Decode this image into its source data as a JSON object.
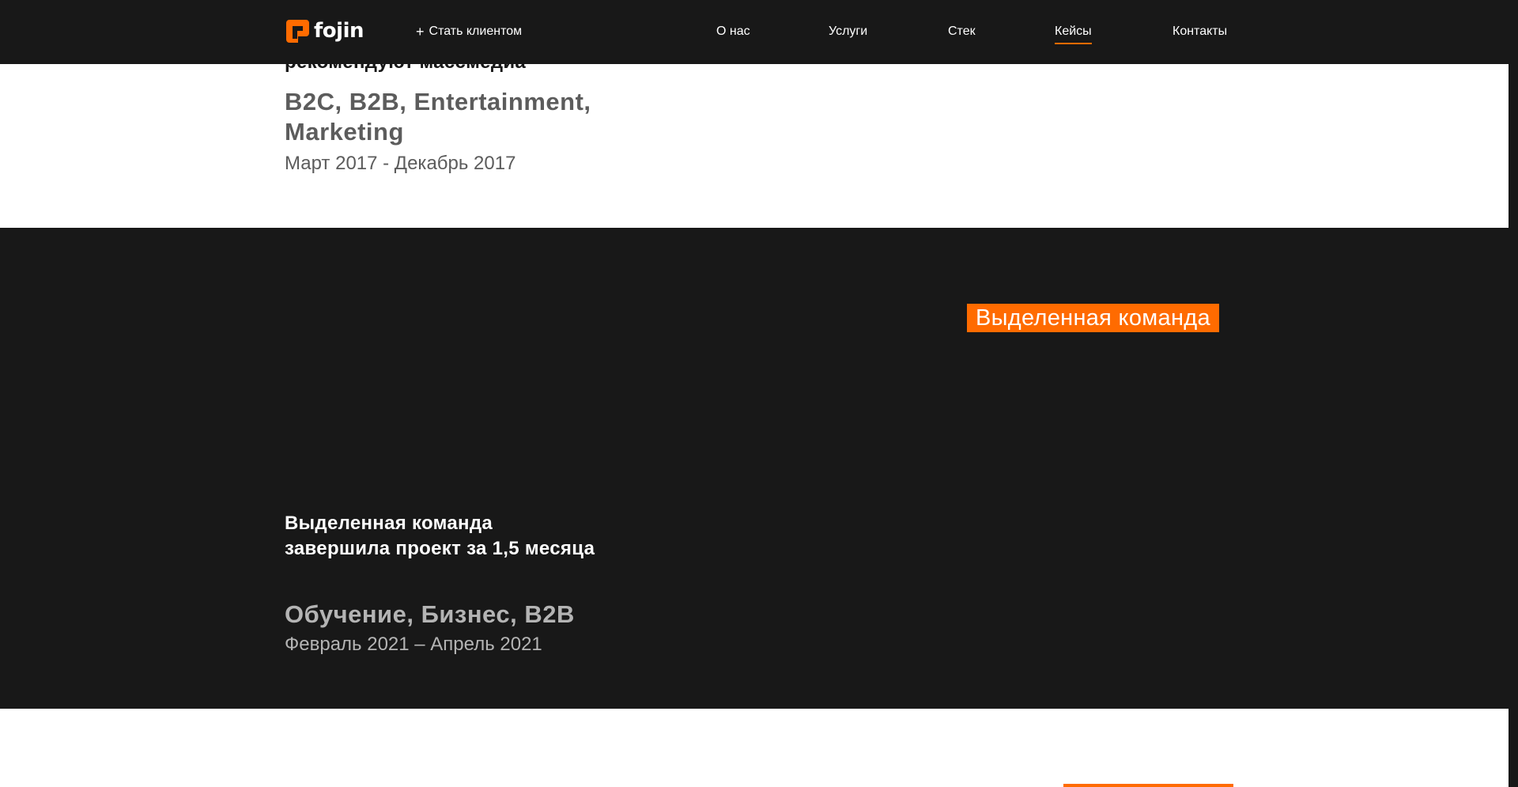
{
  "header": {
    "logo_text": "fojin",
    "become_client_label": "Стать клиентом",
    "nav": [
      {
        "label": "О нас",
        "active": false
      },
      {
        "label": "Услуги",
        "active": false
      },
      {
        "label": "Стек",
        "active": false
      },
      {
        "label": "Кейсы",
        "active": true
      },
      {
        "label": "Контакты",
        "active": false
      }
    ]
  },
  "cases": [
    {
      "title": "рекомендуют массмедиа",
      "tags": "B2C, B2B, Entertainment, Marketing",
      "period": "Март 2017 - Декабрь 2017"
    },
    {
      "badge": "Выделенная команда",
      "title": "Выделенная команда завершила проект за 1,5 месяца",
      "tags": "Обучение, Бизнес, B2B",
      "period": "Февраль 2021 – Апрель 2021"
    }
  ],
  "colors": {
    "accent": "#ff6b00",
    "dark": "#181818",
    "light": "#ffffff",
    "muted_dark": "#5c5c5c",
    "muted_light": "#b4b4b4"
  }
}
